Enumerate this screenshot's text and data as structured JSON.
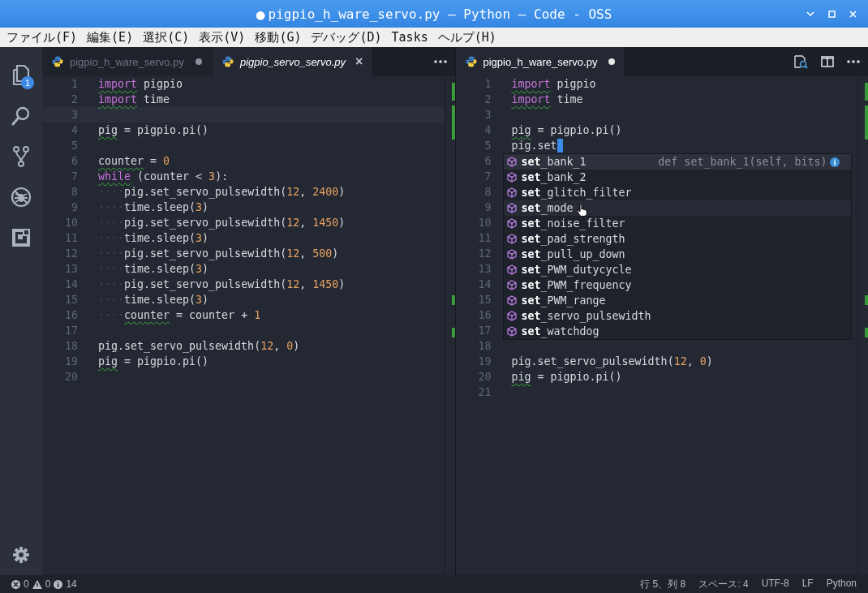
{
  "window": {
    "title": "pigpio_h_ware_servo.py — Python — Code - OSS",
    "dirty_mark": "●"
  },
  "menu": [
    "ファイル(F)",
    "編集(E)",
    "選択(C)",
    "表示(V)",
    "移動(G)",
    "デバッグ(D)",
    "Tasks",
    "ヘルプ(H)"
  ],
  "activity_bar": [
    {
      "kind": "files",
      "badge": "1"
    },
    {
      "kind": "search"
    },
    {
      "kind": "source-control"
    },
    {
      "kind": "debug"
    },
    {
      "kind": "extensions"
    },
    {
      "kind": "settings"
    }
  ],
  "editor_groups": [
    {
      "tabs": [
        {
          "label": "pigpio_h_ware_servo.py",
          "selected": false,
          "preview": false,
          "dirty": true
        },
        {
          "label": "pigpio_servo_servo.py",
          "selected": true,
          "preview": true,
          "dirty": false,
          "close": "×"
        }
      ],
      "actions": [
        {
          "kind": "more"
        }
      ],
      "lines": [
        {
          "number": "1",
          "tokens": [
            {
              "text": "import",
              "kind": "keyword",
              "squiggle": true
            },
            {
              "text": " pigpio",
              "kind": "text"
            }
          ]
        },
        {
          "number": "2",
          "tokens": [
            {
              "text": "import",
              "kind": "keyword",
              "squiggle": true
            },
            {
              "text": " time",
              "kind": "text"
            }
          ]
        },
        {
          "number": "3",
          "current": true
        },
        {
          "number": "4",
          "tokens": [
            {
              "text": "pig",
              "kind": "text",
              "squiggle": true
            },
            {
              "text": " = pigpio.pi()",
              "kind": "text"
            }
          ]
        },
        {
          "number": "5"
        },
        {
          "number": "6",
          "tokens": [
            {
              "text": "counter",
              "kind": "text",
              "squiggle": true
            },
            {
              "text": " = ",
              "kind": "text"
            },
            {
              "text": "0",
              "kind": "number"
            }
          ]
        },
        {
          "number": "7",
          "tokens": [
            {
              "text": "while",
              "kind": "keyword",
              "squiggle": true
            },
            {
              "text": " (counter < ",
              "kind": "text"
            },
            {
              "text": "3",
              "kind": "number"
            },
            {
              "text": "):",
              "kind": "text"
            }
          ]
        },
        {
          "number": "8",
          "tokens": [
            {
              "text": "····",
              "kind": "whitespace"
            },
            {
              "text": "pig.set_servo_pulsewidth(",
              "kind": "text"
            },
            {
              "text": "12",
              "kind": "number"
            },
            {
              "text": ", ",
              "kind": "text"
            },
            {
              "text": "2400",
              "kind": "number"
            },
            {
              "text": ")",
              "kind": "text"
            }
          ]
        },
        {
          "number": "9",
          "tokens": [
            {
              "text": "····",
              "kind": "whitespace"
            },
            {
              "text": "time.sleep(",
              "kind": "text"
            },
            {
              "text": "3",
              "kind": "number"
            },
            {
              "text": ")",
              "kind": "text"
            }
          ]
        },
        {
          "number": "10",
          "tokens": [
            {
              "text": "····",
              "kind": "whitespace"
            },
            {
              "text": "pig.set_servo_pulsewidth(",
              "kind": "text"
            },
            {
              "text": "12",
              "kind": "number"
            },
            {
              "text": ", ",
              "kind": "text"
            },
            {
              "text": "1450",
              "kind": "number"
            },
            {
              "text": ")",
              "kind": "text"
            }
          ]
        },
        {
          "number": "11",
          "tokens": [
            {
              "text": "····",
              "kind": "whitespace"
            },
            {
              "text": "time.sleep(",
              "kind": "text"
            },
            {
              "text": "3",
              "kind": "number"
            },
            {
              "text": ")",
              "kind": "text"
            }
          ]
        },
        {
          "number": "12",
          "tokens": [
            {
              "text": "····",
              "kind": "whitespace"
            },
            {
              "text": "pig.set_servo_pulsewidth(",
              "kind": "text"
            },
            {
              "text": "12",
              "kind": "number"
            },
            {
              "text": ", ",
              "kind": "text"
            },
            {
              "text": "500",
              "kind": "number"
            },
            {
              "text": ")",
              "kind": "text"
            }
          ]
        },
        {
          "number": "13",
          "tokens": [
            {
              "text": "····",
              "kind": "whitespace"
            },
            {
              "text": "time.sleep(",
              "kind": "text"
            },
            {
              "text": "3",
              "kind": "number"
            },
            {
              "text": ")",
              "kind": "text"
            }
          ]
        },
        {
          "number": "14",
          "tokens": [
            {
              "text": "····",
              "kind": "whitespace"
            },
            {
              "text": "pig.set_servo_pulsewidth(",
              "kind": "text"
            },
            {
              "text": "12",
              "kind": "number"
            },
            {
              "text": ", ",
              "kind": "text"
            },
            {
              "text": "1450",
              "kind": "number"
            },
            {
              "text": ")",
              "kind": "text"
            }
          ]
        },
        {
          "number": "15",
          "tokens": [
            {
              "text": "····",
              "kind": "whitespace"
            },
            {
              "text": "time.sleep(",
              "kind": "text"
            },
            {
              "text": "3",
              "kind": "number"
            },
            {
              "text": ")",
              "kind": "text"
            }
          ]
        },
        {
          "number": "16",
          "tokens": [
            {
              "text": "····",
              "kind": "whitespace"
            },
            {
              "text": "counter",
              "kind": "text",
              "squiggle": true
            },
            {
              "text": " = counter + ",
              "kind": "text"
            },
            {
              "text": "1",
              "kind": "number"
            }
          ]
        },
        {
          "number": "17"
        },
        {
          "number": "18",
          "tokens": [
            {
              "text": "pig.set_servo_pulsewidth(",
              "kind": "text"
            },
            {
              "text": "12",
              "kind": "number"
            },
            {
              "text": ", ",
              "kind": "text"
            },
            {
              "text": "0",
              "kind": "number"
            },
            {
              "text": ")",
              "kind": "text"
            }
          ]
        },
        {
          "number": "19",
          "tokens": [
            {
              "text": "pig",
              "kind": "text",
              "squiggle": true
            },
            {
              "text": " = pigpio.pi()",
              "kind": "text"
            }
          ]
        },
        {
          "number": "20"
        }
      ]
    },
    {
      "tabs": [
        {
          "label": "pigpio_h_ware_servo.py",
          "selected": true,
          "preview": false,
          "dirty": true
        }
      ],
      "actions": [
        {
          "kind": "open-preview"
        },
        {
          "kind": "split-editor"
        },
        {
          "kind": "more"
        }
      ],
      "lines": [
        {
          "number": "1",
          "tokens": [
            {
              "text": "import",
              "kind": "keyword",
              "squiggle": true
            },
            {
              "text": " pigpio",
              "kind": "text"
            }
          ]
        },
        {
          "number": "2",
          "tokens": [
            {
              "text": "import",
              "kind": "keyword",
              "squiggle": true
            },
            {
              "text": " time",
              "kind": "text"
            }
          ]
        },
        {
          "number": "3"
        },
        {
          "number": "4",
          "tokens": [
            {
              "text": "pig",
              "kind": "text",
              "squiggle": true
            },
            {
              "text": " = pigpio.pi()",
              "kind": "text"
            }
          ]
        },
        {
          "number": "5",
          "cursor": true,
          "tokens": [
            {
              "text": "pig.set",
              "kind": "text"
            }
          ]
        },
        {
          "number": "6"
        },
        {
          "number": "7"
        },
        {
          "number": "8"
        },
        {
          "number": "9"
        },
        {
          "number": "10"
        },
        {
          "number": "11"
        },
        {
          "number": "12"
        },
        {
          "number": "13"
        },
        {
          "number": "14"
        },
        {
          "number": "15"
        },
        {
          "number": "16"
        },
        {
          "number": "17"
        },
        {
          "number": "18"
        },
        {
          "number": "19",
          "tokens": [
            {
              "text": "pig.set_servo_pulsewidth(",
              "kind": "text"
            },
            {
              "text": "12",
              "kind": "number"
            },
            {
              "text": ", ",
              "kind": "text"
            },
            {
              "text": "0",
              "kind": "number"
            },
            {
              "text": ")",
              "kind": "text"
            }
          ]
        },
        {
          "number": "20",
          "tokens": [
            {
              "text": "pig",
              "kind": "text",
              "squiggle": true
            },
            {
              "text": " = pigpio.pi()",
              "kind": "text"
            }
          ]
        },
        {
          "number": "21"
        }
      ],
      "suggest": {
        "items": [
          {
            "match": "set",
            "rest": "_bank_1",
            "selected": true,
            "hovered": false,
            "detail": "def set_bank_1(self, bits)"
          },
          {
            "match": "set",
            "rest": "_bank_2",
            "selected": false,
            "hovered": false
          },
          {
            "match": "set",
            "rest": "_glitch_filter",
            "selected": false,
            "hovered": false
          },
          {
            "match": "set",
            "rest": "_mode",
            "selected": false,
            "hovered": true
          },
          {
            "match": "set",
            "rest": "_noise_filter",
            "selected": false,
            "hovered": false
          },
          {
            "match": "set",
            "rest": "_pad_strength",
            "selected": false,
            "hovered": false
          },
          {
            "match": "set",
            "rest": "_pull_up_down",
            "selected": false,
            "hovered": false
          },
          {
            "match": "set",
            "rest": "_PWM_dutycycle",
            "selected": false,
            "hovered": false
          },
          {
            "match": "set",
            "rest": "_PWM_frequency",
            "selected": false,
            "hovered": false
          },
          {
            "match": "set",
            "rest": "_PWM_range",
            "selected": false,
            "hovered": false
          },
          {
            "match": "set",
            "rest": "_servo_pulsewidth",
            "selected": false,
            "hovered": false
          },
          {
            "match": "set",
            "rest": "_watchdog",
            "selected": false,
            "hovered": false
          }
        ]
      }
    }
  ],
  "status_bar": {
    "errors": "0",
    "warnings": "0",
    "infos": "14",
    "right": [
      "行 5、列 8",
      "スペース: 4",
      "UTF-8",
      "LF",
      "Python"
    ]
  }
}
